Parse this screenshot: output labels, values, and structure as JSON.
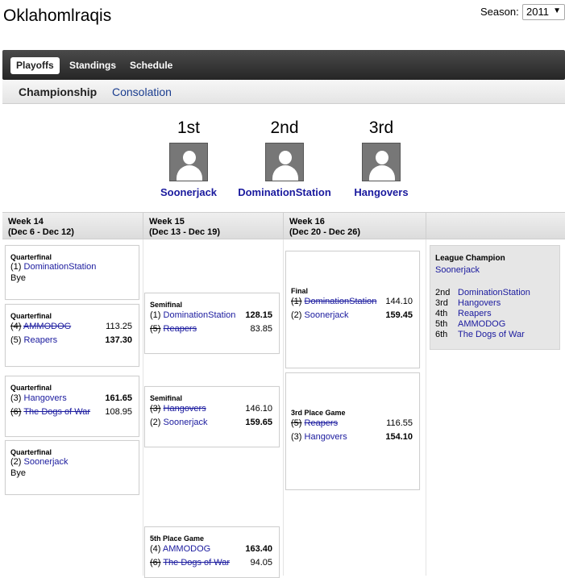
{
  "league": {
    "title": "Oklahomlraqis"
  },
  "season": {
    "label": "Season:",
    "value": "2011",
    "arrow": "▼"
  },
  "nav": {
    "tabs": [
      "Playoffs",
      "Standings",
      "Schedule"
    ]
  },
  "subnav": {
    "active": "Championship",
    "other": "Consolation"
  },
  "podium": [
    {
      "place": "1st",
      "team": "Soonerjack"
    },
    {
      "place": "2nd",
      "team": "DominationStation"
    },
    {
      "place": "3rd",
      "team": "Hangovers"
    }
  ],
  "weeks": [
    {
      "name": "Week 14",
      "dates": "(Dec 6 - Dec 12)"
    },
    {
      "name": "Week 15",
      "dates": "(Dec 13 - Dec 19)"
    },
    {
      "name": "Week 16",
      "dates": "(Dec 20 - Dec 26)"
    }
  ],
  "matches": {
    "qf1": {
      "title": "Quarterfinal",
      "seed": "(1)",
      "team": "DominationStation",
      "bye": "Bye"
    },
    "qf2": {
      "title": "Quarterfinal",
      "a": {
        "seed": "(4)",
        "team": "AMMODOG",
        "score": "113.25"
      },
      "b": {
        "seed": "(5)",
        "team": "Reapers",
        "score": "137.30"
      }
    },
    "qf3": {
      "title": "Quarterfinal",
      "a": {
        "seed": "(3)",
        "team": "Hangovers",
        "score": "161.65"
      },
      "b": {
        "seed": "(6)",
        "team": "The Dogs of War",
        "score": "108.95"
      }
    },
    "qf4": {
      "title": "Quarterfinal",
      "seed": "(2)",
      "team": "Soonerjack",
      "bye": "Bye"
    },
    "sf1": {
      "title": "Semifinal",
      "a": {
        "seed": "(1)",
        "team": "DominationStation",
        "score": "128.15"
      },
      "b": {
        "seed": "(5)",
        "team": "Reapers",
        "score": "83.85"
      }
    },
    "sf2": {
      "title": "Semifinal",
      "a": {
        "seed": "(3)",
        "team": "Hangovers",
        "score": "146.10"
      },
      "b": {
        "seed": "(2)",
        "team": "Soonerjack",
        "score": "159.65"
      }
    },
    "fifth": {
      "title": "5th Place Game",
      "a": {
        "seed": "(4)",
        "team": "AMMODOG",
        "score": "163.40"
      },
      "b": {
        "seed": "(6)",
        "team": "The Dogs of War",
        "score": "94.05"
      }
    },
    "final": {
      "title": "Final",
      "a": {
        "seed": "(1)",
        "team": "DominationStation",
        "score": "144.10"
      },
      "b": {
        "seed": "(2)",
        "team": "Soonerjack",
        "score": "159.45"
      }
    },
    "third": {
      "title": "3rd Place Game",
      "a": {
        "seed": "(5)",
        "team": "Reapers",
        "score": "116.55"
      },
      "b": {
        "seed": "(3)",
        "team": "Hangovers",
        "score": "154.10"
      }
    }
  },
  "champion": {
    "title": "League Champion",
    "team": "Soonerjack",
    "ranks": [
      {
        "place": "2nd",
        "team": "DominationStation"
      },
      {
        "place": "3rd",
        "team": "Hangovers"
      },
      {
        "place": "4th",
        "team": "Reapers"
      },
      {
        "place": "5th",
        "team": "AMMODOG"
      },
      {
        "place": "6th",
        "team": "The Dogs of War"
      }
    ]
  }
}
